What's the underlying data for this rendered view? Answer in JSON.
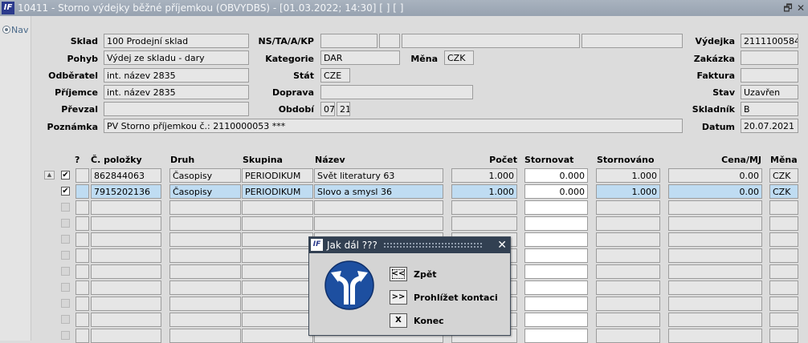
{
  "window": {
    "title": "10411 - Storno výdejky běžné příjemkou (OBVYDBS) - [01.03.2022; 14:30]  [ ]  [ ]",
    "logo": "IF",
    "restore_glyph": "🗗",
    "close_glyph": "✕"
  },
  "nav": {
    "label": "Nav"
  },
  "form": {
    "sklad": {
      "label": "Sklad",
      "value": "100 Prodejní sklad"
    },
    "pohyb": {
      "label": "Pohyb",
      "value": "Výdej ze skladu - dary"
    },
    "odberatel": {
      "label": "Odběratel",
      "value": "int. název 2835"
    },
    "prijemce": {
      "label": "Příjemce",
      "value": "int. název 2835"
    },
    "prevzal": {
      "label": "Převzal",
      "value": ""
    },
    "poznamka": {
      "label": "Poznámka",
      "value": "PV Storno příjemkou č.: 2110000053 ***"
    },
    "ns": {
      "label": "NS/TA/A/KP",
      "values": [
        "",
        "",
        "",
        ""
      ]
    },
    "kategorie": {
      "label": "Kategorie",
      "value": "DAR"
    },
    "mena": {
      "label": "Měna",
      "value": "CZK"
    },
    "stat": {
      "label": "Stát",
      "value": "CZE"
    },
    "doprava": {
      "label": "Doprava",
      "value": ""
    },
    "obdobi": {
      "label": "Období",
      "month": "07",
      "year": "21"
    },
    "vydejka": {
      "label": "Výdejka",
      "value": "2111100584"
    },
    "zakazka": {
      "label": "Zakázka",
      "value": ""
    },
    "faktura": {
      "label": "Faktura",
      "value": ""
    },
    "stav": {
      "label": "Stav",
      "value": "Uzavřen"
    },
    "skladnik": {
      "label": "Skladník",
      "value": "B"
    },
    "datum": {
      "label": "Datum",
      "value": "20.07.2021"
    }
  },
  "table": {
    "headers": {
      "q": "?",
      "cislo": "Č. položky",
      "druh": "Druh",
      "skupina": "Skupina",
      "nazev": "Název",
      "pocet": "Počet",
      "stornovat": "Stornovat",
      "stornovano": "Stornováno",
      "cena": "Cena/MJ",
      "mena": "Měna"
    },
    "rows": [
      {
        "checked": "✔",
        "cislo": "862844063",
        "druh": "Časopisy",
        "skupina": "PERIODIKUM",
        "nazev": "Svět literatury 63",
        "pocet": "1.000",
        "stornovat": "0.000",
        "stornovano": "1.000",
        "cena": "0.00",
        "mena": "CZK"
      },
      {
        "checked": "✔",
        "cislo": "7915202136",
        "druh": "Časopisy",
        "skupina": "PERIODIKUM",
        "nazev": "Slovo a smysl 36",
        "pocet": "1.000",
        "stornovat": "0.000",
        "stornovano": "1.000",
        "cena": "0.00",
        "mena": "CZK"
      }
    ],
    "scroll_up_glyph": "▲"
  },
  "dialog": {
    "title": "Jak dál ???",
    "logo": "IF",
    "close_glyph": "✕",
    "buttons": [
      {
        "key": "<<",
        "label": "Zpět"
      },
      {
        "key": ">>",
        "label": "Prohlížet kontaci"
      },
      {
        "key": "X",
        "label": "Konec"
      }
    ],
    "colors": {
      "sign": "#1d4fa0",
      "title_bar": "#324052"
    }
  }
}
